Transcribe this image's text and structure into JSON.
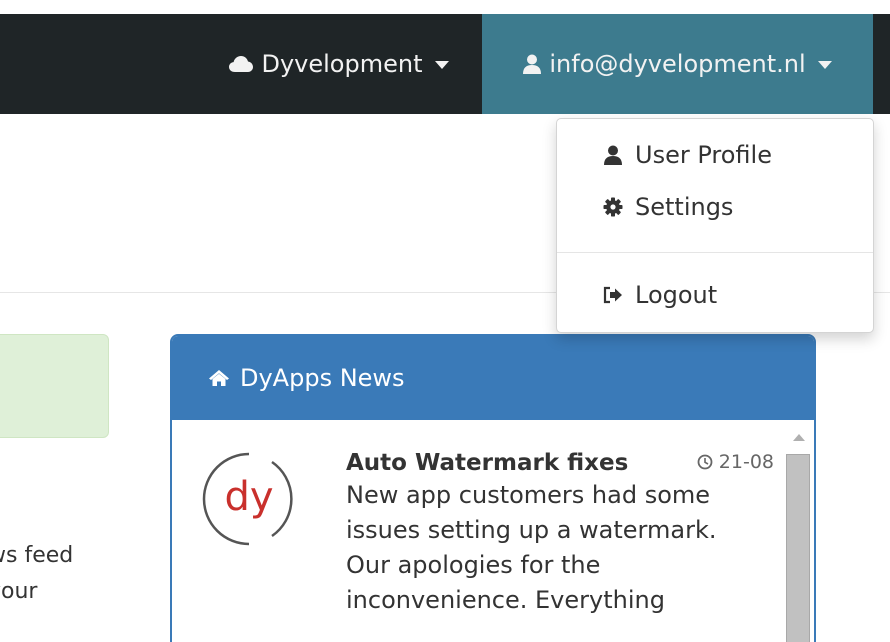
{
  "navbar": {
    "brand_menu_label": "Dyvelopment",
    "brand_icon": "cloud-icon",
    "user_menu_label": "info@dyvelopment.nl",
    "user_icon": "user-icon",
    "colors": {
      "bar": "#1f2527",
      "active": "#3d7b8e"
    }
  },
  "dropdown": {
    "items": [
      {
        "label": "User Profile",
        "icon": "user-icon"
      },
      {
        "label": "Settings",
        "icon": "gear-icon"
      },
      {
        "label": "Logout",
        "icon": "logout-icon"
      }
    ]
  },
  "left_panel": {
    "text_lines": [
      "ws feed",
      "your"
    ]
  },
  "news": {
    "header": "DyApps News",
    "header_icon": "home-icon",
    "color": "#3a7ab8",
    "items": [
      {
        "title": "Auto Watermark fixes",
        "date": "21-08",
        "logo_text": "dy",
        "lines": [
          "New app customers had some",
          "issues setting up a watermark.",
          "Our apologies for the",
          "inconvenience. Everything"
        ]
      }
    ]
  }
}
